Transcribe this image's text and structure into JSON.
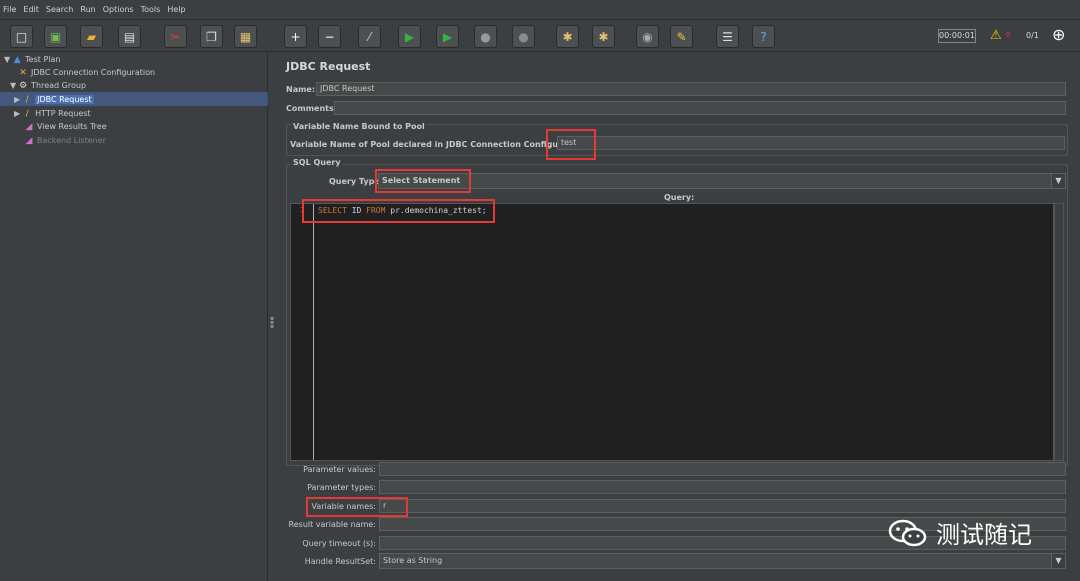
{
  "menu": [
    "File",
    "Edit",
    "Search",
    "Run",
    "Options",
    "Tools",
    "Help"
  ],
  "toolbar": {
    "buttons": [
      {
        "name": "new-icon",
        "glyph": "□",
        "color": "#e8e8e8"
      },
      {
        "name": "templates-icon",
        "glyph": "▣",
        "color": "#6fbf4f"
      },
      {
        "name": "open-icon",
        "glyph": "▰",
        "color": "#f0b030"
      },
      {
        "name": "save-icon",
        "glyph": "▤",
        "color": "#dddddd"
      },
      {
        "name": "cut-icon",
        "glyph": "✂",
        "color": "#e53935"
      },
      {
        "name": "copy-icon",
        "glyph": "❐",
        "color": "#dddddd"
      },
      {
        "name": "paste-icon",
        "glyph": "▦",
        "color": "#e8c070"
      },
      {
        "name": "expand-icon",
        "glyph": "+",
        "color": "#ffffff"
      },
      {
        "name": "collapse-icon",
        "glyph": "−",
        "color": "#ffffff"
      },
      {
        "name": "toggle-icon",
        "glyph": "⁄",
        "color": "#cccccc"
      },
      {
        "name": "start-icon",
        "glyph": "▶",
        "color": "#3cb043"
      },
      {
        "name": "start-no-pause-icon",
        "glyph": "▶",
        "color": "#3cb043"
      },
      {
        "name": "stop-icon",
        "glyph": "●",
        "color": "#9a9a9a"
      },
      {
        "name": "shutdown-icon",
        "glyph": "●",
        "color": "#8a8a8a"
      },
      {
        "name": "clear-icon",
        "glyph": "✱",
        "color": "#e8c070"
      },
      {
        "name": "clear-all-icon",
        "glyph": "✱",
        "color": "#e8c070"
      },
      {
        "name": "search-icon",
        "glyph": "◉",
        "color": "#aaaaaa"
      },
      {
        "name": "reset-search-icon",
        "glyph": "✎",
        "color": "#f0c040"
      },
      {
        "name": "function-helper-icon",
        "glyph": "☰",
        "color": "#dddddd"
      },
      {
        "name": "help-icon",
        "glyph": "?",
        "color": "#6fa8dc"
      }
    ],
    "timer": "00:00:01",
    "warnings": "0",
    "threads": "0/1"
  },
  "tree": [
    {
      "label": "Test Plan",
      "icon": "test-plan-icon",
      "glyph": "▲",
      "color": "#4a90d9",
      "expander": "▼"
    },
    {
      "label": "JDBC Connection Configuration",
      "icon": "config-element-icon",
      "glyph": "✕",
      "color": "#e0b050",
      "expander": ""
    },
    {
      "label": "Thread Group",
      "icon": "thread-group-icon",
      "glyph": "⚙",
      "color": "#dddddd",
      "expander": "▼"
    },
    {
      "label": "JDBC Request",
      "icon": "sampler-icon",
      "glyph": "/",
      "color": "#e0b050",
      "expander": "▶",
      "selected": true
    },
    {
      "label": "HTTP Request",
      "icon": "sampler-icon",
      "glyph": "/",
      "color": "#e0b050",
      "expander": "▶"
    },
    {
      "label": "View Results Tree",
      "icon": "listener-icon",
      "glyph": "◢",
      "color": "#d070d0",
      "expander": ""
    },
    {
      "label": "Backend Listener",
      "icon": "listener-icon",
      "glyph": "◢",
      "color": "#d070d0",
      "expander": "",
      "disabled": true
    }
  ],
  "panel": {
    "title": "JDBC Request",
    "name_label": "Name:",
    "name_value": "JDBC Request",
    "comments_label": "Comments:",
    "pool_group": "Variable Name Bound to Pool",
    "pool_label": "Variable Name of Pool declared in JDBC Connection Configuration:",
    "pool_value": "test",
    "sql_group": "SQL Query",
    "query_type_label": "Query Type:",
    "query_type_value": "Select Statement",
    "query_label": "Query:",
    "query_line_no": "1",
    "query_kw1": "SELECT",
    "query_mid": " ID ",
    "query_kw2": "FROM",
    "query_rest": " pr.demochina_zttest;",
    "param_values_label": "Parameter values:",
    "param_types_label": "Parameter types:",
    "var_names_label": "Variable names:",
    "var_names_value": "r",
    "result_var_label": "Result variable name:",
    "timeout_label": "Query timeout (s):",
    "handle_label": "Handle ResultSet:",
    "handle_value": "Store as String"
  },
  "watermark": "测试随记"
}
